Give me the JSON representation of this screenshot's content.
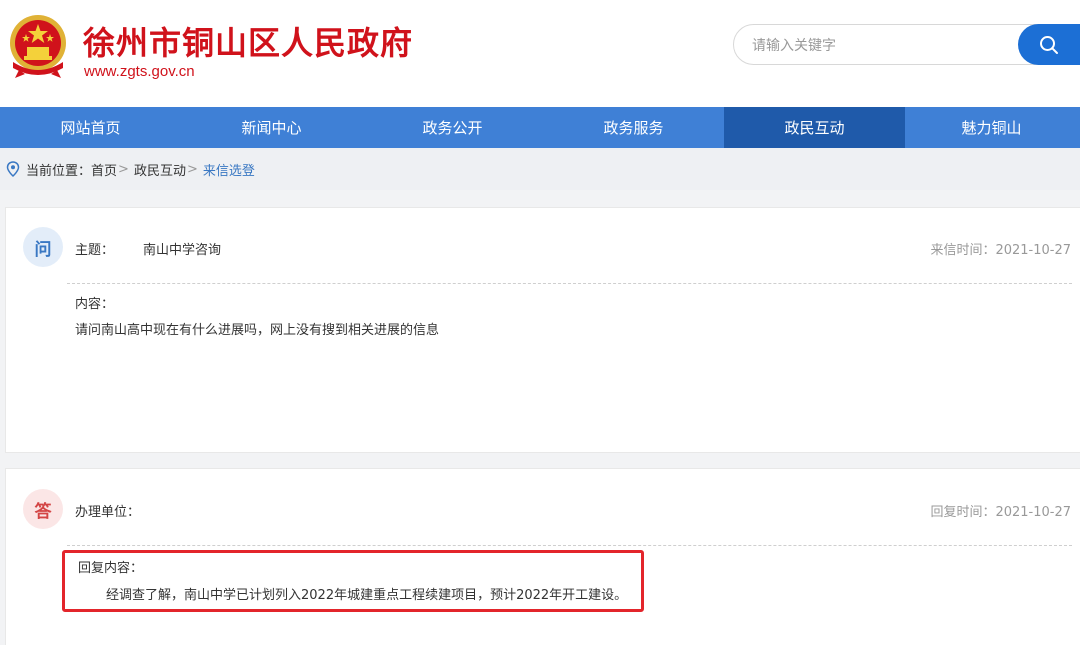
{
  "header": {
    "site_title": "徐州市铜山区人民政府",
    "site_url": "www.zgts.gov.cn",
    "emblem_icon": "national-emblem-icon"
  },
  "search": {
    "placeholder": "请输入关键字",
    "button_icon": "search-icon"
  },
  "nav": {
    "items": [
      {
        "label": "网站首页",
        "active": false
      },
      {
        "label": "新闻中心",
        "active": false
      },
      {
        "label": "政务公开",
        "active": false
      },
      {
        "label": "政务服务",
        "active": false
      },
      {
        "label": "政民互动",
        "active": true
      },
      {
        "label": "魅力铜山",
        "active": false
      }
    ]
  },
  "breadcrumb": {
    "prefix": "当前位置：",
    "home": "首页",
    "section": "政民互动",
    "current": "来信选登",
    "separator": ">"
  },
  "question": {
    "badge": "问",
    "subject_label": "主题：",
    "subject_value": "南山中学咨询",
    "time_label": "来信时间：2021-10-27",
    "content_label": "内容：",
    "content_text": "请问南山高中现在有什么进展吗，网上没有搜到相关进展的信息"
  },
  "answer": {
    "badge": "答",
    "unit_label": "办理单位：",
    "time_label": "回复时间：2021-10-27",
    "content_label": "回复内容：",
    "content_text": "经调查了解，南山中学已计划列入2022年城建重点工程续建项目，预计2022年开工建设。"
  },
  "colors": {
    "brand_red": "#d0121b",
    "nav_blue": "#3f80d6",
    "nav_active": "#1f5aaa",
    "highlight_red": "#e3252b"
  }
}
